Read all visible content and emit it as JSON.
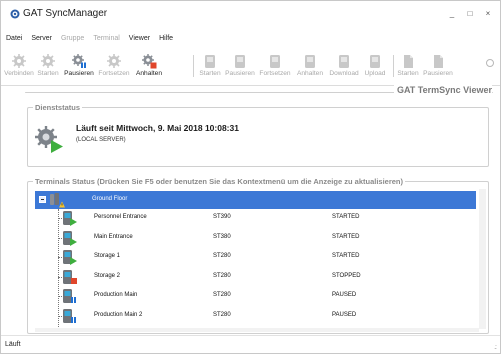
{
  "window": {
    "title": "GAT SyncManager",
    "controls": [
      "_",
      "□",
      "×"
    ]
  },
  "menu": [
    {
      "label": "Datei",
      "enabled": true
    },
    {
      "label": "Server",
      "enabled": true
    },
    {
      "label": "Gruppe",
      "enabled": false
    },
    {
      "label": "Terminal",
      "enabled": false
    },
    {
      "label": "Viewer",
      "enabled": true
    },
    {
      "label": "Hilfe",
      "enabled": true
    }
  ],
  "toolbar": {
    "server_buttons": [
      {
        "label": "Verbinden",
        "enabled": false,
        "icon": "gear-connect-icon"
      },
      {
        "label": "Starten",
        "enabled": false,
        "icon": "gear-start-icon"
      },
      {
        "label": "Pausieren",
        "enabled": true,
        "icon": "gear-pause-icon"
      },
      {
        "label": "Fortsetzen",
        "enabled": false,
        "icon": "gear-resume-icon"
      },
      {
        "label": "Anhalten",
        "enabled": true,
        "icon": "gear-stop-icon"
      }
    ],
    "terminal_buttons": [
      {
        "label": "Starten",
        "enabled": false,
        "icon": "terminal-start-icon"
      },
      {
        "label": "Pausieren",
        "enabled": false,
        "icon": "terminal-pause-icon"
      },
      {
        "label": "Fortsetzen",
        "enabled": false,
        "icon": "terminal-resume-icon"
      },
      {
        "label": "Anhalten",
        "enabled": false,
        "icon": "terminal-stop-icon"
      },
      {
        "label": "Download",
        "enabled": false,
        "icon": "terminal-download-icon"
      },
      {
        "label": "Upload",
        "enabled": false,
        "icon": "terminal-upload-icon"
      }
    ],
    "doc_buttons": [
      {
        "label": "Starten",
        "enabled": false,
        "icon": "doc-start-icon"
      },
      {
        "label": "Pausieren",
        "enabled": false,
        "icon": "doc-pause-icon"
      }
    ]
  },
  "viewer": {
    "title": "GAT TermSync Viewer"
  },
  "service": {
    "group_label": "Dienststatus",
    "status": "Läuft seit Mittwoch, 9. Mai 2018 10:08:31",
    "server": "(LOCAL SERVER)"
  },
  "terminals": {
    "group_label": "Terminals Status (Drücken Sie F5 oder benutzen Sie das Kontextmenü um die Anzeige zu aktualisieren)",
    "group_name": "Ground Floor",
    "rows": [
      {
        "name": "Personnel Entrance",
        "type": "ST390",
        "status": "STARTED",
        "state": "started"
      },
      {
        "name": "Main Entrance",
        "type": "ST380",
        "status": "STARTED",
        "state": "started"
      },
      {
        "name": "Storage 1",
        "type": "ST280",
        "status": "STARTED",
        "state": "started"
      },
      {
        "name": "Storage 2",
        "type": "ST280",
        "status": "STOPPED",
        "state": "stopped"
      },
      {
        "name": "Production Main",
        "type": "ST280",
        "status": "PAUSED",
        "state": "paused"
      },
      {
        "name": "Production Main 2",
        "type": "ST280",
        "status": "PAUSED",
        "state": "paused"
      }
    ]
  },
  "statusbar": {
    "text": "Läuft"
  },
  "colors": {
    "selection": "#3c78d6",
    "started": "#3fae3f",
    "stopped": "#e0462b",
    "paused": "#1f6fd1",
    "terminal": "#6f7378"
  }
}
